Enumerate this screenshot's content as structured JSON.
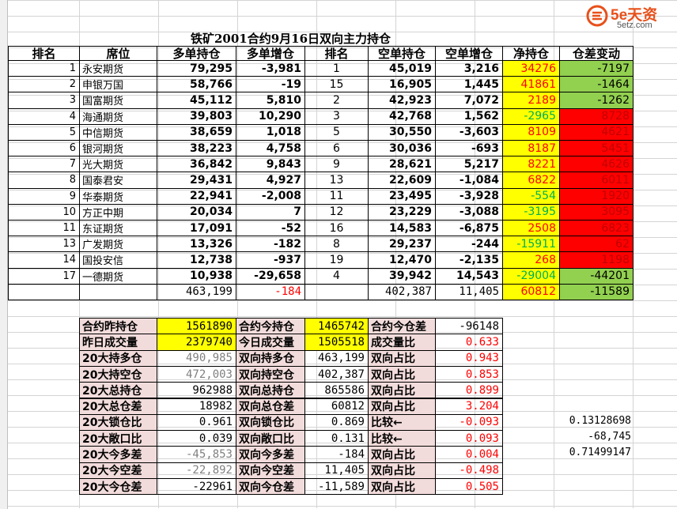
{
  "title": "铁矿2001合约9月16日双向主力持仓",
  "logo": {
    "brand": "5e天资",
    "site": "5etz.com"
  },
  "headers": [
    "排名",
    "席位",
    "多单持仓",
    "多单增仓",
    "排名",
    "空单持仓",
    "空单增仓",
    "净持仓",
    "仓差变动"
  ],
  "rows": [
    {
      "rank": "1",
      "seat": "永安期货",
      "long": "79,295",
      "long_chg": "-3,981",
      "srank": "1",
      "short": "45,019",
      "short_chg": "3,216",
      "net": "34276",
      "diff": "-7197"
    },
    {
      "rank": "2",
      "seat": "申银万国",
      "long": "58,766",
      "long_chg": "-19",
      "srank": "15",
      "short": "16,905",
      "short_chg": "1,445",
      "net": "41861",
      "diff": "-1464"
    },
    {
      "rank": "3",
      "seat": "国富期货",
      "long": "45,112",
      "long_chg": "5,810",
      "srank": "2",
      "short": "42,923",
      "short_chg": "7,072",
      "net": "2189",
      "diff": "-1262"
    },
    {
      "rank": "4",
      "seat": "海通期货",
      "long": "39,803",
      "long_chg": "10,290",
      "srank": "3",
      "short": "42,768",
      "short_chg": "1,562",
      "net": "-2965",
      "diff": "8728"
    },
    {
      "rank": "5",
      "seat": "中信期货",
      "long": "38,659",
      "long_chg": "1,018",
      "srank": "5",
      "short": "30,550",
      "short_chg": "-3,603",
      "net": "8109",
      "diff": "4621"
    },
    {
      "rank": "6",
      "seat": "银河期货",
      "long": "38,223",
      "long_chg": "4,758",
      "srank": "6",
      "short": "30,036",
      "short_chg": "-693",
      "net": "8187",
      "diff": "5451"
    },
    {
      "rank": "7",
      "seat": "光大期货",
      "long": "36,842",
      "long_chg": "9,843",
      "srank": "9",
      "short": "28,621",
      "short_chg": "5,217",
      "net": "8221",
      "diff": "4626"
    },
    {
      "rank": "8",
      "seat": "国泰君安",
      "long": "29,431",
      "long_chg": "4,927",
      "srank": "13",
      "short": "22,609",
      "short_chg": "-1,084",
      "net": "6822",
      "diff": "6011"
    },
    {
      "rank": "9",
      "seat": "华泰期货",
      "long": "22,941",
      "long_chg": "-2,008",
      "srank": "11",
      "short": "23,495",
      "short_chg": "-3,928",
      "net": "-554",
      "diff": "1920"
    },
    {
      "rank": "10",
      "seat": "方正中期",
      "long": "20,034",
      "long_chg": "7",
      "srank": "12",
      "short": "23,229",
      "short_chg": "-3,088",
      "net": "-3195",
      "diff": "3095"
    },
    {
      "rank": "11",
      "seat": "东证期货",
      "long": "17,091",
      "long_chg": "-52",
      "srank": "16",
      "short": "14,583",
      "short_chg": "-6,875",
      "net": "2508",
      "diff": "6823"
    },
    {
      "rank": "13",
      "seat": "广发期货",
      "long": "13,326",
      "long_chg": "-182",
      "srank": "8",
      "short": "29,237",
      "short_chg": "-244",
      "net": "-15911",
      "diff": "62"
    },
    {
      "rank": "14",
      "seat": "国投安信",
      "long": "12,738",
      "long_chg": "-937",
      "srank": "19",
      "short": "12,470",
      "short_chg": "-2,135",
      "net": "268",
      "diff": "1198"
    },
    {
      "rank": "17",
      "seat": "一德期货",
      "long": "10,938",
      "long_chg": "-29,658",
      "srank": "4",
      "short": "39,942",
      "short_chg": "14,543",
      "net": "-29004",
      "diff": "-44201"
    }
  ],
  "totals": {
    "long": "463,199",
    "long_chg": "-184",
    "short": "402,387",
    "short_chg": "11,405",
    "net": "60812",
    "diff": "-11589"
  },
  "summary": [
    {
      "l1": "合约昨持仓",
      "v1": "1561890",
      "l2": "合约今持仓",
      "v2": "1465742",
      "l3": "合约今仓差",
      "v3": "-96148"
    },
    {
      "l1": "昨日成交量",
      "v1": "2379740",
      "l2": "今日成交量",
      "v2": "1505518",
      "l3": "成交量比",
      "v3": "0.633"
    },
    {
      "l1": "20大持多仓",
      "v1": "490,985",
      "l2": "双向持多仓",
      "v2": "463,199",
      "l3": "双向占比",
      "v3": "0.943"
    },
    {
      "l1": "20大持空仓",
      "v1": "472,003",
      "l2": "双向持空仓",
      "v2": "402,387",
      "l3": "双向占比",
      "v3": "0.853"
    },
    {
      "l1": "20大总持仓",
      "v1": "962988",
      "l2": "双向总持仓",
      "v2": "865586",
      "l3": "双向占比",
      "v3": "0.899"
    },
    {
      "l1": "20大总仓差",
      "v1": "18982",
      "l2": "双向总仓差",
      "v2": "60812",
      "l3": "双向占比",
      "v3": "3.204"
    },
    {
      "l1": "20大锁仓比",
      "v1": "0.961",
      "l2": "双向锁仓比",
      "v2": "0.869",
      "l3": "比较←",
      "v3": "-0.093"
    },
    {
      "l1": "20大敞口比",
      "v1": "0.039",
      "l2": "双向敞口比",
      "v2": "0.131",
      "l3": "比较←",
      "v3": "0.093"
    },
    {
      "l1": "20大今多差",
      "v1": "-45,853",
      "l2": "双向今多差",
      "v2": "-184",
      "l3": "双向占比",
      "v3": "0.004"
    },
    {
      "l1": "20大今空差",
      "v1": "-22,892",
      "l2": "双向今空差",
      "v2": "11,405",
      "l3": "双向占比",
      "v3": "-0.498"
    },
    {
      "l1": "20大今仓差",
      "v1": "-22961",
      "l2": "双向今仓差",
      "v2": "-11,589",
      "l3": "双向占比",
      "v3": "0.505"
    }
  ],
  "extras": [
    "0.13128698",
    "-68,745",
    "0.71499147"
  ],
  "row_headers": [
    "",
    "",
    "5",
    "",
    "",
    "",
    "",
    "",
    "6",
    "",
    "",
    "",
    "",
    "",
    "",
    "",
    "",
    "",
    "",
    "",
    "",
    "",
    "2",
    "3",
    "",
    "5",
    "",
    "",
    "",
    "",
    "",
    "0",
    "1",
    "2"
  ]
}
